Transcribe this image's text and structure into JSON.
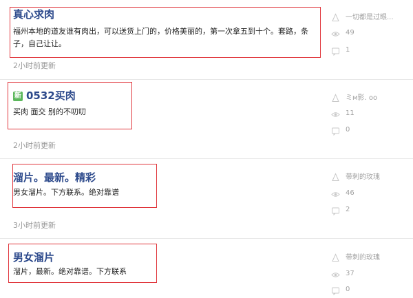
{
  "posts": [
    {
      "title": "真心求肉",
      "excerpt": "福州本地的道友谁有肉出，可以送货上门的，价格美丽的，第一次拿五到十个。套路，条子，自己让让。",
      "time": "2小时前更新",
      "author": "一切都是过眼...",
      "views": "49",
      "comments": "1"
    },
    {
      "badge": "新",
      "title": "0532买肉",
      "excerpt": "买肉 面交 别的不叨叨",
      "time": "2小时前更新",
      "author": "ミм影. oo",
      "views": "11",
      "comments": "0"
    },
    {
      "title": "溜片。最新。精彩",
      "excerpt": "男女溜片。下方联系。绝对靠谱",
      "time": "3小时前更新",
      "author": "带刺的玫瑰",
      "views": "46",
      "comments": "2"
    },
    {
      "title": "男女溜片",
      "excerpt": "溜片，最新。绝对靠谱。下方联系",
      "time": "",
      "author": "带刺的玫瑰",
      "views": "37",
      "comments": "0"
    }
  ],
  "icons": {
    "author": "user-icon",
    "views": "eye-icon",
    "comments": "comment-icon"
  },
  "colors": {
    "title": "#2d4a8c",
    "highlight": "#e0363c",
    "badge": "#5cb85c",
    "meta": "#a0a0a0"
  }
}
